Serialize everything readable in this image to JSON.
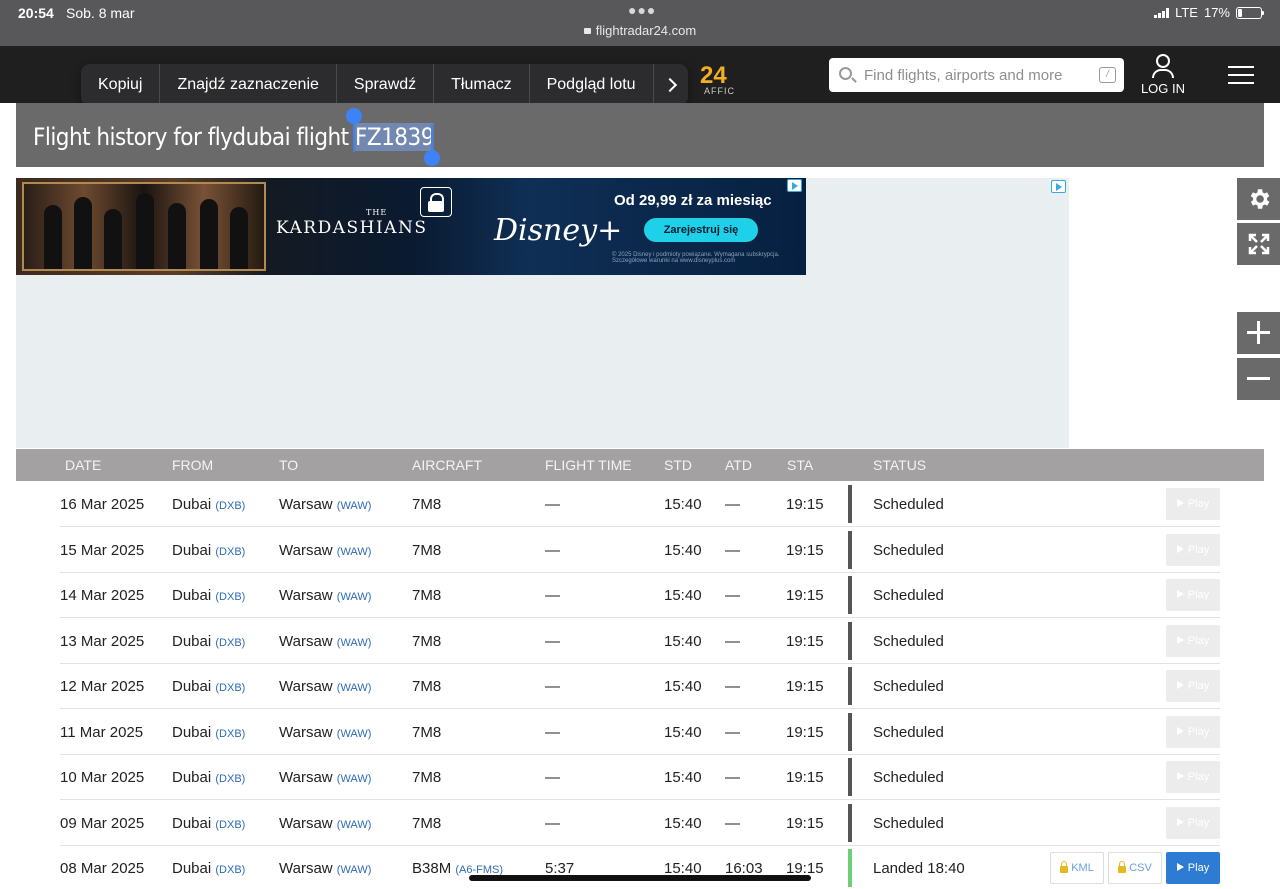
{
  "statusbar": {
    "time": "20:54",
    "date": "Sob. 8 mar",
    "url": "flightradar24.com",
    "network": "LTE",
    "battery": "17%",
    "battery_level": 0.17
  },
  "nav": {
    "logo_number": "24",
    "logo_suffix": "AFFIC",
    "search_placeholder": "Find flights, airports and more",
    "search_shortcut": "/",
    "login_label": "LOG IN"
  },
  "context_menu": {
    "items": [
      "Kopiuj",
      "Znajdź zaznaczenie",
      "Sprawdź",
      "Tłumacz",
      "Podgląd lotu"
    ]
  },
  "page": {
    "title_prefix": "Flight history for flydubai flight ",
    "flight_number": "FZ1839"
  },
  "ad": {
    "title_small": "THE",
    "title": "KARDASHIANS",
    "brand": "Disney+",
    "price": "Od 29,99 zł za miesiąc",
    "cta": "Zarejestruj się",
    "fine_print": "© 2025 Disney i podmioty powiązane. Wymagana subskrypcja. Szczegółowe warunki na www.disneyplus.com"
  },
  "table": {
    "headers": {
      "date": "DATE",
      "from": "FROM",
      "to": "TO",
      "aircraft": "AIRCRAFT",
      "flight_time": "FLIGHT TIME",
      "std": "STD",
      "atd": "ATD",
      "sta": "STA",
      "status": "STATUS"
    },
    "play_label": "Play",
    "kml_label": "KML",
    "csv_label": "CSV",
    "rows": [
      {
        "date": "16 Mar 2025",
        "from": "Dubai",
        "from_code": "(DXB)",
        "to": "Warsaw",
        "to_code": "(WAW)",
        "aircraft": "7M8",
        "reg": "",
        "flight_time": "—",
        "std": "15:40",
        "atd": "—",
        "sta": "19:15",
        "status": "Scheduled"
      },
      {
        "date": "15 Mar 2025",
        "from": "Dubai",
        "from_code": "(DXB)",
        "to": "Warsaw",
        "to_code": "(WAW)",
        "aircraft": "7M8",
        "reg": "",
        "flight_time": "—",
        "std": "15:40",
        "atd": "—",
        "sta": "19:15",
        "status": "Scheduled"
      },
      {
        "date": "14 Mar 2025",
        "from": "Dubai",
        "from_code": "(DXB)",
        "to": "Warsaw",
        "to_code": "(WAW)",
        "aircraft": "7M8",
        "reg": "",
        "flight_time": "—",
        "std": "15:40",
        "atd": "—",
        "sta": "19:15",
        "status": "Scheduled"
      },
      {
        "date": "13 Mar 2025",
        "from": "Dubai",
        "from_code": "(DXB)",
        "to": "Warsaw",
        "to_code": "(WAW)",
        "aircraft": "7M8",
        "reg": "",
        "flight_time": "—",
        "std": "15:40",
        "atd": "—",
        "sta": "19:15",
        "status": "Scheduled"
      },
      {
        "date": "12 Mar 2025",
        "from": "Dubai",
        "from_code": "(DXB)",
        "to": "Warsaw",
        "to_code": "(WAW)",
        "aircraft": "7M8",
        "reg": "",
        "flight_time": "—",
        "std": "15:40",
        "atd": "—",
        "sta": "19:15",
        "status": "Scheduled"
      },
      {
        "date": "11 Mar 2025",
        "from": "Dubai",
        "from_code": "(DXB)",
        "to": "Warsaw",
        "to_code": "(WAW)",
        "aircraft": "7M8",
        "reg": "",
        "flight_time": "—",
        "std": "15:40",
        "atd": "—",
        "sta": "19:15",
        "status": "Scheduled"
      },
      {
        "date": "10 Mar 2025",
        "from": "Dubai",
        "from_code": "(DXB)",
        "to": "Warsaw",
        "to_code": "(WAW)",
        "aircraft": "7M8",
        "reg": "",
        "flight_time": "—",
        "std": "15:40",
        "atd": "—",
        "sta": "19:15",
        "status": "Scheduled"
      },
      {
        "date": "09 Mar 2025",
        "from": "Dubai",
        "from_code": "(DXB)",
        "to": "Warsaw",
        "to_code": "(WAW)",
        "aircraft": "7M8",
        "reg": "",
        "flight_time": "—",
        "std": "15:40",
        "atd": "—",
        "sta": "19:15",
        "status": "Scheduled"
      },
      {
        "date": "08 Mar 2025",
        "from": "Dubai",
        "from_code": "(DXB)",
        "to": "Warsaw",
        "to_code": "(WAW)",
        "aircraft": "B38M",
        "reg": "(A6-FMS)",
        "flight_time": "5:37",
        "std": "15:40",
        "atd": "16:03",
        "sta": "19:15",
        "status": "Landed 18:40"
      }
    ]
  },
  "colors": {
    "accent": "#f3b022",
    "link": "#2d6cb5",
    "play_active": "#2d7bd2",
    "landed": "#6ccf73",
    "selection": "#3e82f7"
  }
}
